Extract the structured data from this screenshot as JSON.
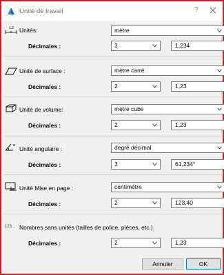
{
  "window": {
    "title": "Unité de travail",
    "help_label": "?"
  },
  "sections": {
    "unites": {
      "label": "Unités:",
      "icon": "ruler-scale-icon",
      "unit_value": "mètre",
      "decimals_label": "Décimales :",
      "decimals_value": "3",
      "example": "1,234"
    },
    "surface": {
      "label": "Unité de surface :",
      "icon": "area-parallelogram-icon",
      "unit_value": "mètre carré",
      "decimals_label": "Décimales :",
      "decimals_value": "2",
      "example": "1,23"
    },
    "volume": {
      "label": "Unité de volume:",
      "icon": "volume-box-icon",
      "unit_value": "mètre cube",
      "decimals_label": "Décimales :",
      "decimals_value": "2",
      "example": "1,23"
    },
    "angulaire": {
      "label": "Unité angulaire :",
      "icon": "angle-icon",
      "unit_value": "degré décimal",
      "decimals_label": "Décimales :",
      "decimals_value": "3",
      "example": "61,234°"
    },
    "mise_en_page": {
      "label": "Unité Mise en page :",
      "icon": "layout-page-icon",
      "unit_value": "centimètre",
      "decimals_label": "Décimales :",
      "decimals_value": "2",
      "example": "123,40"
    },
    "sans_unites": {
      "label": "Nombres sans unités (tailles de police, pièces, etc.)",
      "icon_text": "123...",
      "decimals_label": "Décimales :",
      "decimals_value": "2",
      "example": "1,23"
    }
  },
  "buttons": {
    "cancel": "Annuler",
    "ok": "OK"
  },
  "colors": {
    "window_border": "#e81123",
    "ok_border": "#0078d7",
    "dialog_bg": "#f0f0f0"
  }
}
